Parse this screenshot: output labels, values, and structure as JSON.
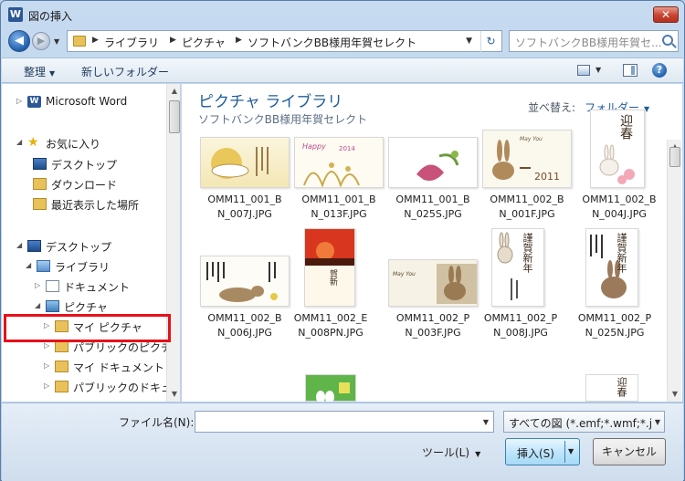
{
  "window": {
    "title": "図の挿入",
    "app_icon": "W",
    "close_glyph": "✕"
  },
  "address": {
    "crumbs": [
      "ライブラリ",
      "ピクチャ",
      "ソフトバンクBB様用年賀セレクト"
    ],
    "search_placeholder": "ソフトバンクBB様用年賀セ..."
  },
  "toolbar": {
    "organize": "整理",
    "new_folder": "新しいフォルダー",
    "help": "?"
  },
  "nav": {
    "items": [
      {
        "label": "Microsoft Word",
        "icon": "word-icon",
        "expander": "▷"
      },
      {
        "label": "お気に入り",
        "icon": "star-icon",
        "expander": "◢"
      },
      {
        "label": "デスクトップ",
        "icon": "desktop-icon",
        "expander": ""
      },
      {
        "label": "ダウンロード",
        "icon": "download-folder-icon",
        "expander": ""
      },
      {
        "label": "最近表示した場所",
        "icon": "recent-places-icon",
        "expander": ""
      },
      {
        "label": "デスクトップ",
        "icon": "desktop-icon",
        "expander": "◢"
      },
      {
        "label": "ライブラリ",
        "icon": "library-icon",
        "expander": "◢"
      },
      {
        "label": "ドキュメント",
        "icon": "documents-icon",
        "expander": "▷"
      },
      {
        "label": "ピクチャ",
        "icon": "pictures-icon",
        "expander": "◢"
      },
      {
        "label": "マイ ピクチャ",
        "icon": "folder-icon",
        "expander": "▷"
      },
      {
        "label": "パブリックのピクチャ",
        "icon": "folder-icon",
        "expander": "▷"
      },
      {
        "label": "マイ ドキュメント",
        "icon": "folder-icon",
        "expander": "▷"
      },
      {
        "label": "パブリックのドキュメント",
        "icon": "folder-icon",
        "expander": "▷"
      }
    ]
  },
  "content": {
    "title": "ピクチャ ライブラリ",
    "subtitle": "ソフトバンクBB様用年賀セレクト",
    "sort_label": "並べ替え:",
    "sort_value": "フォルダー",
    "files": [
      {
        "line1": "OMM11_001_B",
        "line2": "N_007J.JPG"
      },
      {
        "line1": "OMM11_001_B",
        "line2": "N_013F.JPG"
      },
      {
        "line1": "OMM11_001_B",
        "line2": "N_025S.JPG"
      },
      {
        "line1": "OMM11_002_B",
        "line2": "N_001F.JPG"
      },
      {
        "line1": "OMM11_002_B",
        "line2": "N_004J.JPG"
      },
      {
        "line1": "OMM11_002_B",
        "line2": "N_006J.JPG"
      },
      {
        "line1": "OMM11_002_E",
        "line2": "N_008PN.JPG"
      },
      {
        "line1": "OMM11_002_P",
        "line2": "N_003F.JPG"
      },
      {
        "line1": "OMM11_002_P",
        "line2": "N_008J.JPG"
      },
      {
        "line1": "OMM11_002_P",
        "line2": "N_025N.JPG"
      }
    ],
    "thumb_texts": {
      "happy": "Happy",
      "year_2014": "2014",
      "may_you": "May You",
      "year_2011": "2011",
      "kanji_card": "迎春",
      "kanji_nenga": "謹賀新年",
      "kanji_gashin": "賀新",
      "kanji_geisyun": "迎春"
    }
  },
  "bottom": {
    "filename_label": "ファイル名(N):",
    "filename_value": "",
    "filter_value": "すべての図 (*.emf;*.wmf;*.j",
    "tools_label": "ツール(L)",
    "insert_label": "挿入(S)",
    "cancel_label": "キャンセル"
  }
}
